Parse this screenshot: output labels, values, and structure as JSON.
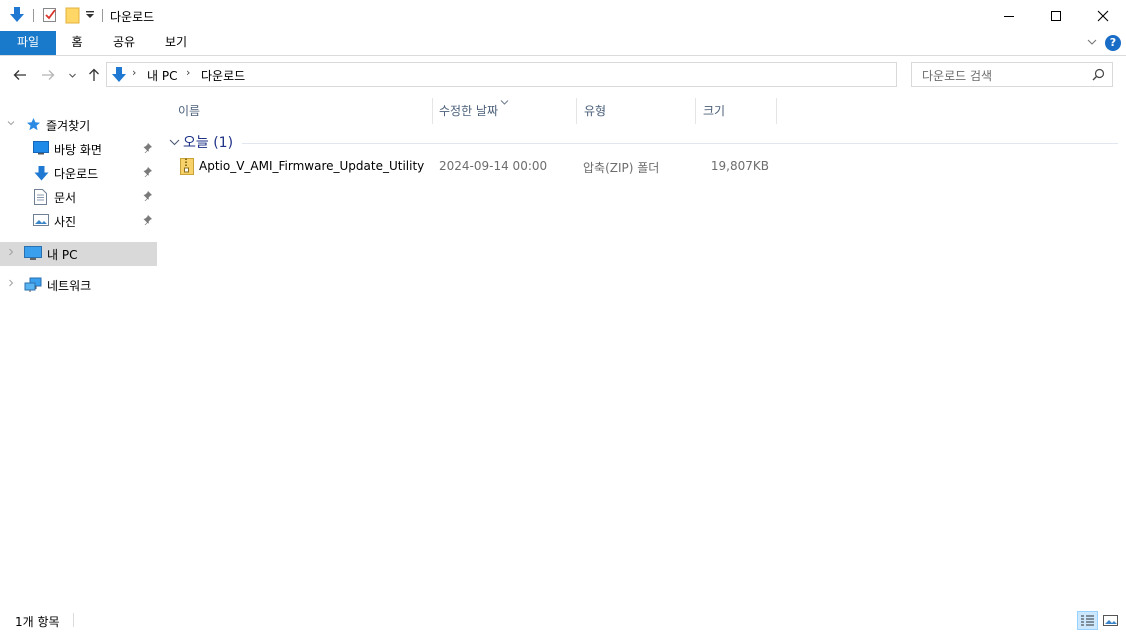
{
  "window": {
    "title": "다운로드"
  },
  "ribbon": {
    "tabs": [
      {
        "label": "파일"
      },
      {
        "label": "홈"
      },
      {
        "label": "공유"
      },
      {
        "label": "보기"
      }
    ],
    "help_label": "?"
  },
  "address": {
    "breadcrumbs": [
      "내 PC",
      "다운로드"
    ],
    "refresh_glyph": "↻"
  },
  "search": {
    "placeholder": "다운로드 검색"
  },
  "navpane": {
    "quick_access": "즐겨찾기",
    "pinned": [
      {
        "label": "바탕 화면"
      },
      {
        "label": "다운로드"
      },
      {
        "label": "문서"
      },
      {
        "label": "사진"
      }
    ],
    "this_pc": "내 PC",
    "network": "네트워크"
  },
  "columns": [
    {
      "label": "이름"
    },
    {
      "label": "수정한 날짜"
    },
    {
      "label": "유형"
    },
    {
      "label": "크기"
    }
  ],
  "group": {
    "label": "오늘 (1)"
  },
  "files": [
    {
      "name": "Aptio_V_AMI_Firmware_Update_Utility",
      "modified": "2024-09-14 00:00",
      "type": "압축(ZIP) 폴더",
      "size": "19,807KB"
    }
  ],
  "status": {
    "item_count": "1개 항목"
  },
  "colors": {
    "accent": "#1979ca",
    "selection": "#d9d9d9",
    "group_text": "#1e3287",
    "header_text": "#4c607a"
  }
}
